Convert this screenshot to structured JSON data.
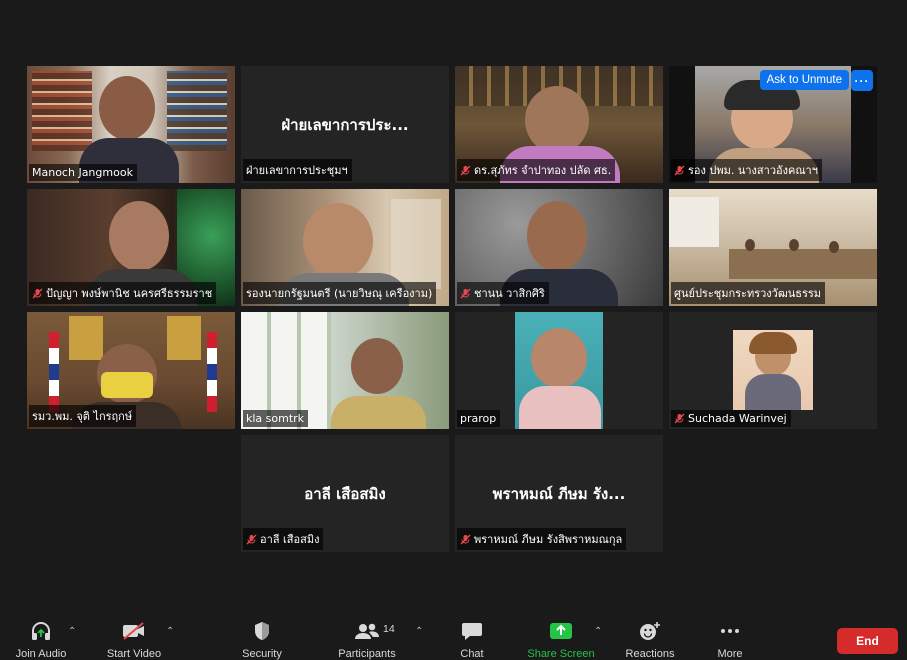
{
  "participants": [
    {
      "big_name": "",
      "label": "Manoch Jangmook",
      "muted": false
    },
    {
      "big_name": "ฝ่ายเลขาการประ...",
      "label": "ฝ่ายเลขาการประชุมฯ",
      "muted": false
    },
    {
      "big_name": "",
      "label": "ดร.สุภัทร จำปาทอง ปลัด ศธ.",
      "muted": true
    },
    {
      "big_name": "",
      "label": "รอง ปพม. นางสาวอังคณาฯ",
      "muted": true
    },
    {
      "big_name": "",
      "label": "ปัญญา พงษ์พานิช นครศรีธรรมราช",
      "muted": true
    },
    {
      "big_name": "",
      "label": "รองนายกรัฐมนตรี (นายวิษณุ เครืองาม)",
      "muted": false
    },
    {
      "big_name": "",
      "label": "ชานน วาสิกศิริ",
      "muted": true
    },
    {
      "big_name": "",
      "label": "ศูนย์ประชุมกระทรวงวัฒนธรรม",
      "muted": false
    },
    {
      "big_name": "",
      "label": "รมว.พม. จุติ ไกรฤกษ์",
      "muted": false
    },
    {
      "big_name": "",
      "label": "kla somtrk",
      "muted": false
    },
    {
      "big_name": "",
      "label": "prarop",
      "muted": false
    },
    {
      "big_name": "",
      "label": "Suchada Warinvej",
      "muted": true
    },
    {
      "big_name": "อาลี  เสือสมิง",
      "label": "อาลี  เสือสมิง",
      "muted": true
    },
    {
      "big_name": "พราหมณ์ ภีษม รัง...",
      "label": "พราหมณ์ ภีษม รังสิพราหมณกุล",
      "muted": true
    }
  ],
  "overlay": {
    "ask_to_unmute": "Ask to Unmute",
    "more": "···"
  },
  "toolbar": {
    "join_audio": "Join Audio",
    "start_video": "Start Video",
    "security": "Security",
    "participants": "Participants",
    "participants_count": "14",
    "chat": "Chat",
    "share_screen": "Share Screen",
    "reactions": "Reactions",
    "more": "More",
    "end": "End"
  },
  "colors": {
    "accent": "#0e72ed",
    "active_speaker": "#9fd53c",
    "end": "#d62b2b",
    "share": "#23c447",
    "muted": "#e5484d"
  }
}
